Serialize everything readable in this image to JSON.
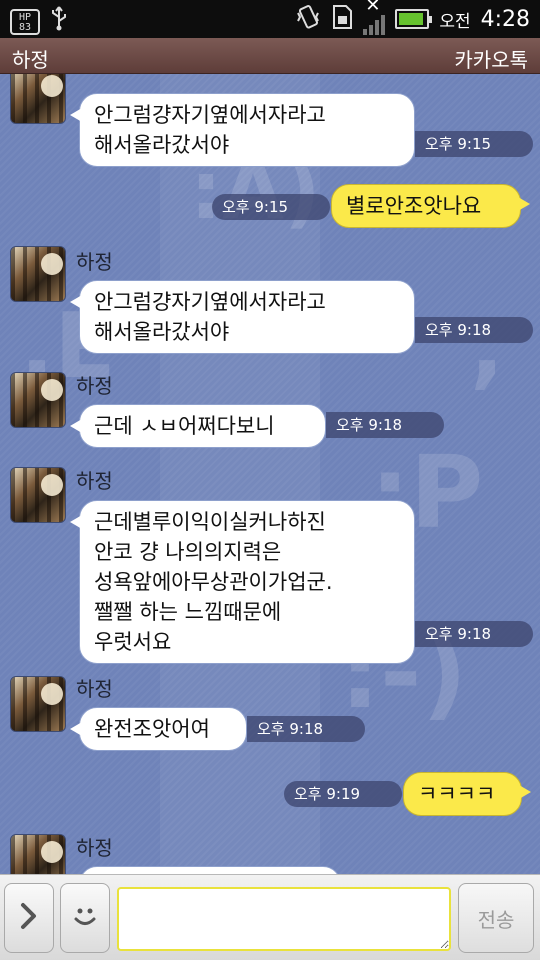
{
  "status_bar": {
    "badge": "HP 83",
    "ampm": "오전",
    "clock": "4:28"
  },
  "title_bar": {
    "contact": "하정",
    "app_name": "카카오톡"
  },
  "messages": [
    {
      "sender": "",
      "text": "안그럼걍자기옆에서자라고\n해서올라갔서야",
      "time": "오후 9:15"
    },
    {
      "text": "별로안조앗나요",
      "time": "오후 9:15"
    },
    {
      "sender": "하정",
      "text": "안그럼걍자기옆에서자라고\n해서올라갔서야",
      "time": "오후 9:18"
    },
    {
      "sender": "하정",
      "text": "근데 ㅅㅂ어쩌다보니",
      "time": "오후 9:18"
    },
    {
      "sender": "하정",
      "text": "근데별루이익이실커나하진\n안코 걍 나의의지력은\n성욕앞에아무상관이가업군.\n쨀쨀 하는 느낌때문에\n우럿서요",
      "time": "오후 9:18"
    },
    {
      "sender": "하정",
      "text": "완전조앗어여",
      "time": "오후 9:18"
    },
    {
      "text": "ㅋㅋㅋㅋ",
      "time": "오후 9:19"
    },
    {
      "sender": "하정",
      "text": ""
    }
  ],
  "input_bar": {
    "placeholder": "",
    "send_label": "전송"
  },
  "colors": {
    "chat_background": "#6f83b9",
    "my_bubble": "#fbe94a",
    "their_bubble": "#ffffff",
    "title_bar": "#6b4a46"
  }
}
